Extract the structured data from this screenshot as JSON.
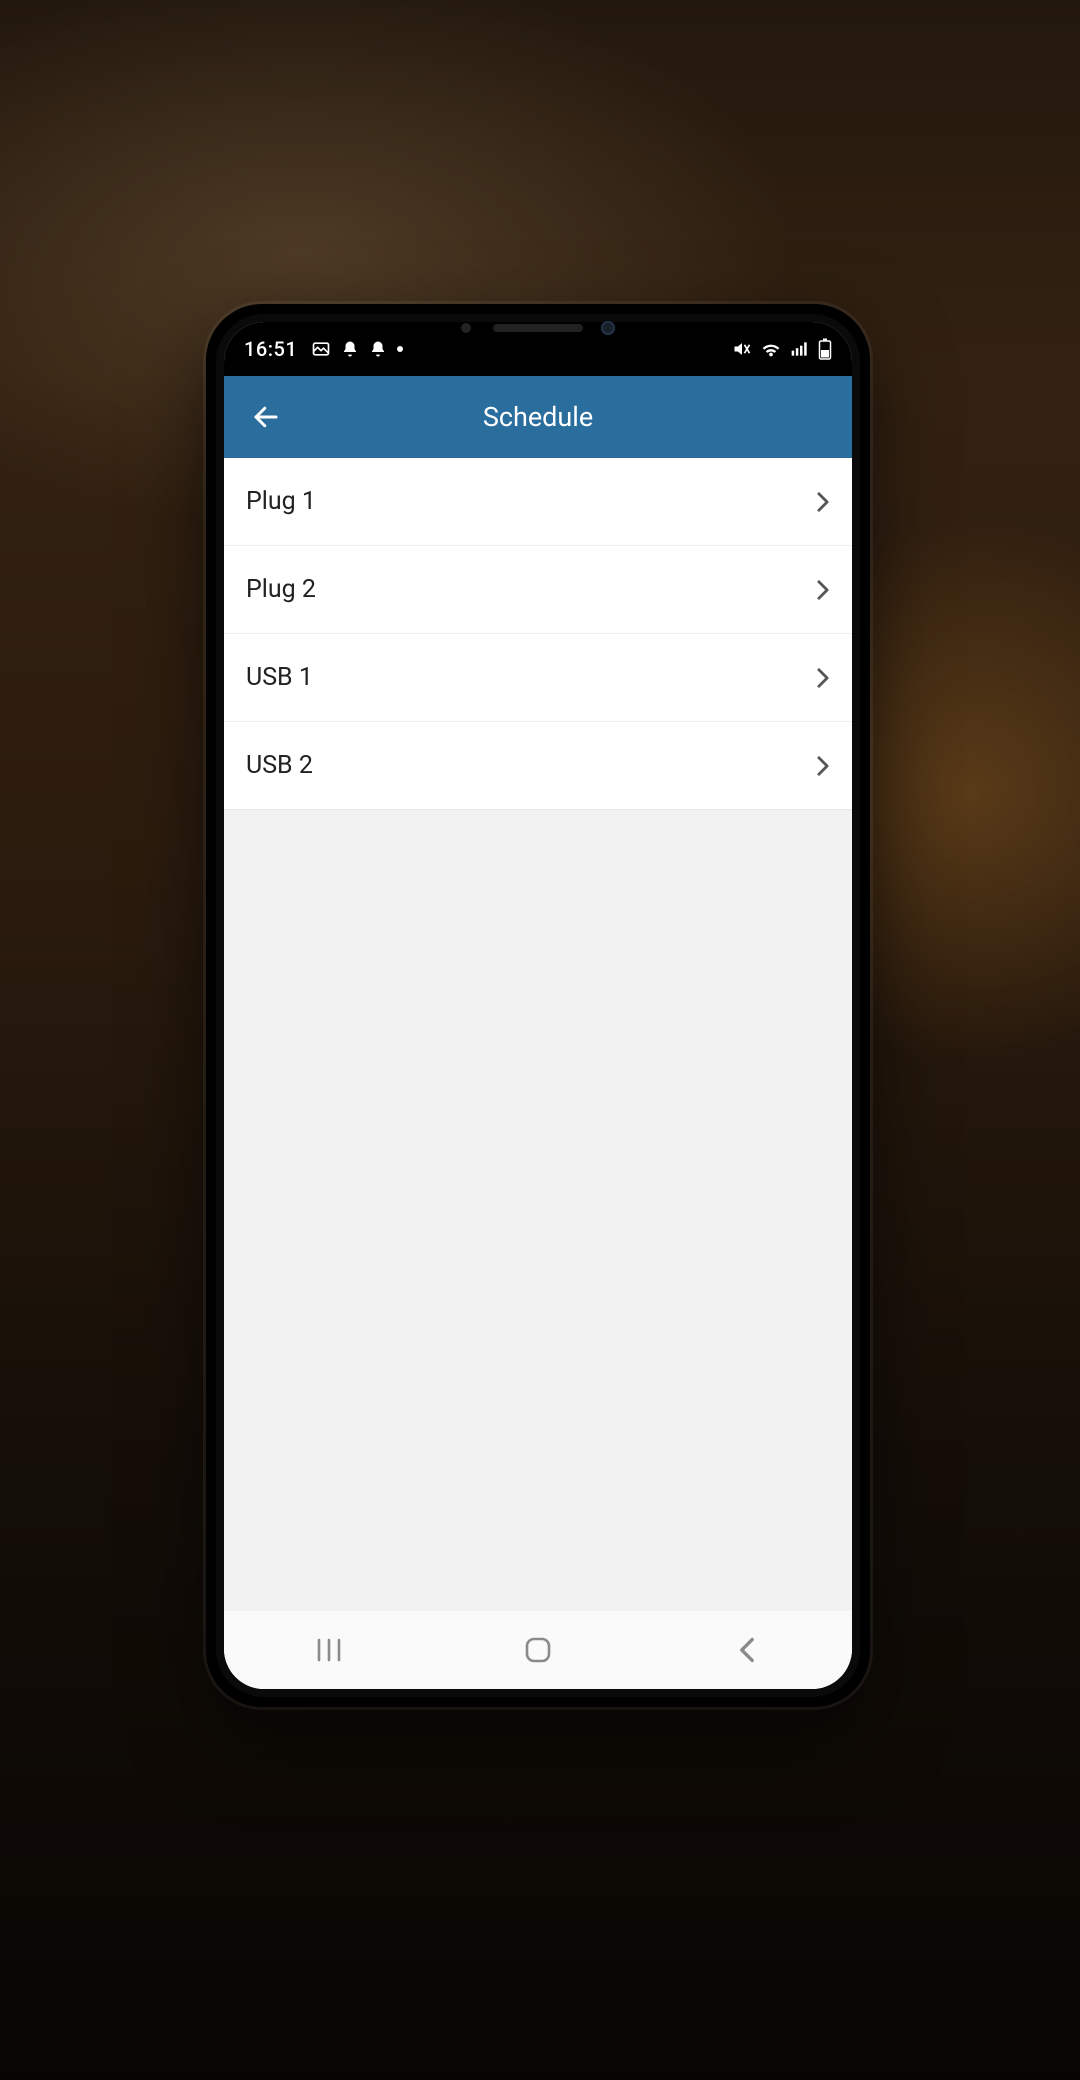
{
  "statusbar": {
    "time": "16:51"
  },
  "appbar": {
    "title": "Schedule"
  },
  "list": {
    "items": [
      {
        "label": "Plug 1"
      },
      {
        "label": "Plug 2"
      },
      {
        "label": "USB 1"
      },
      {
        "label": "USB 2"
      }
    ]
  }
}
